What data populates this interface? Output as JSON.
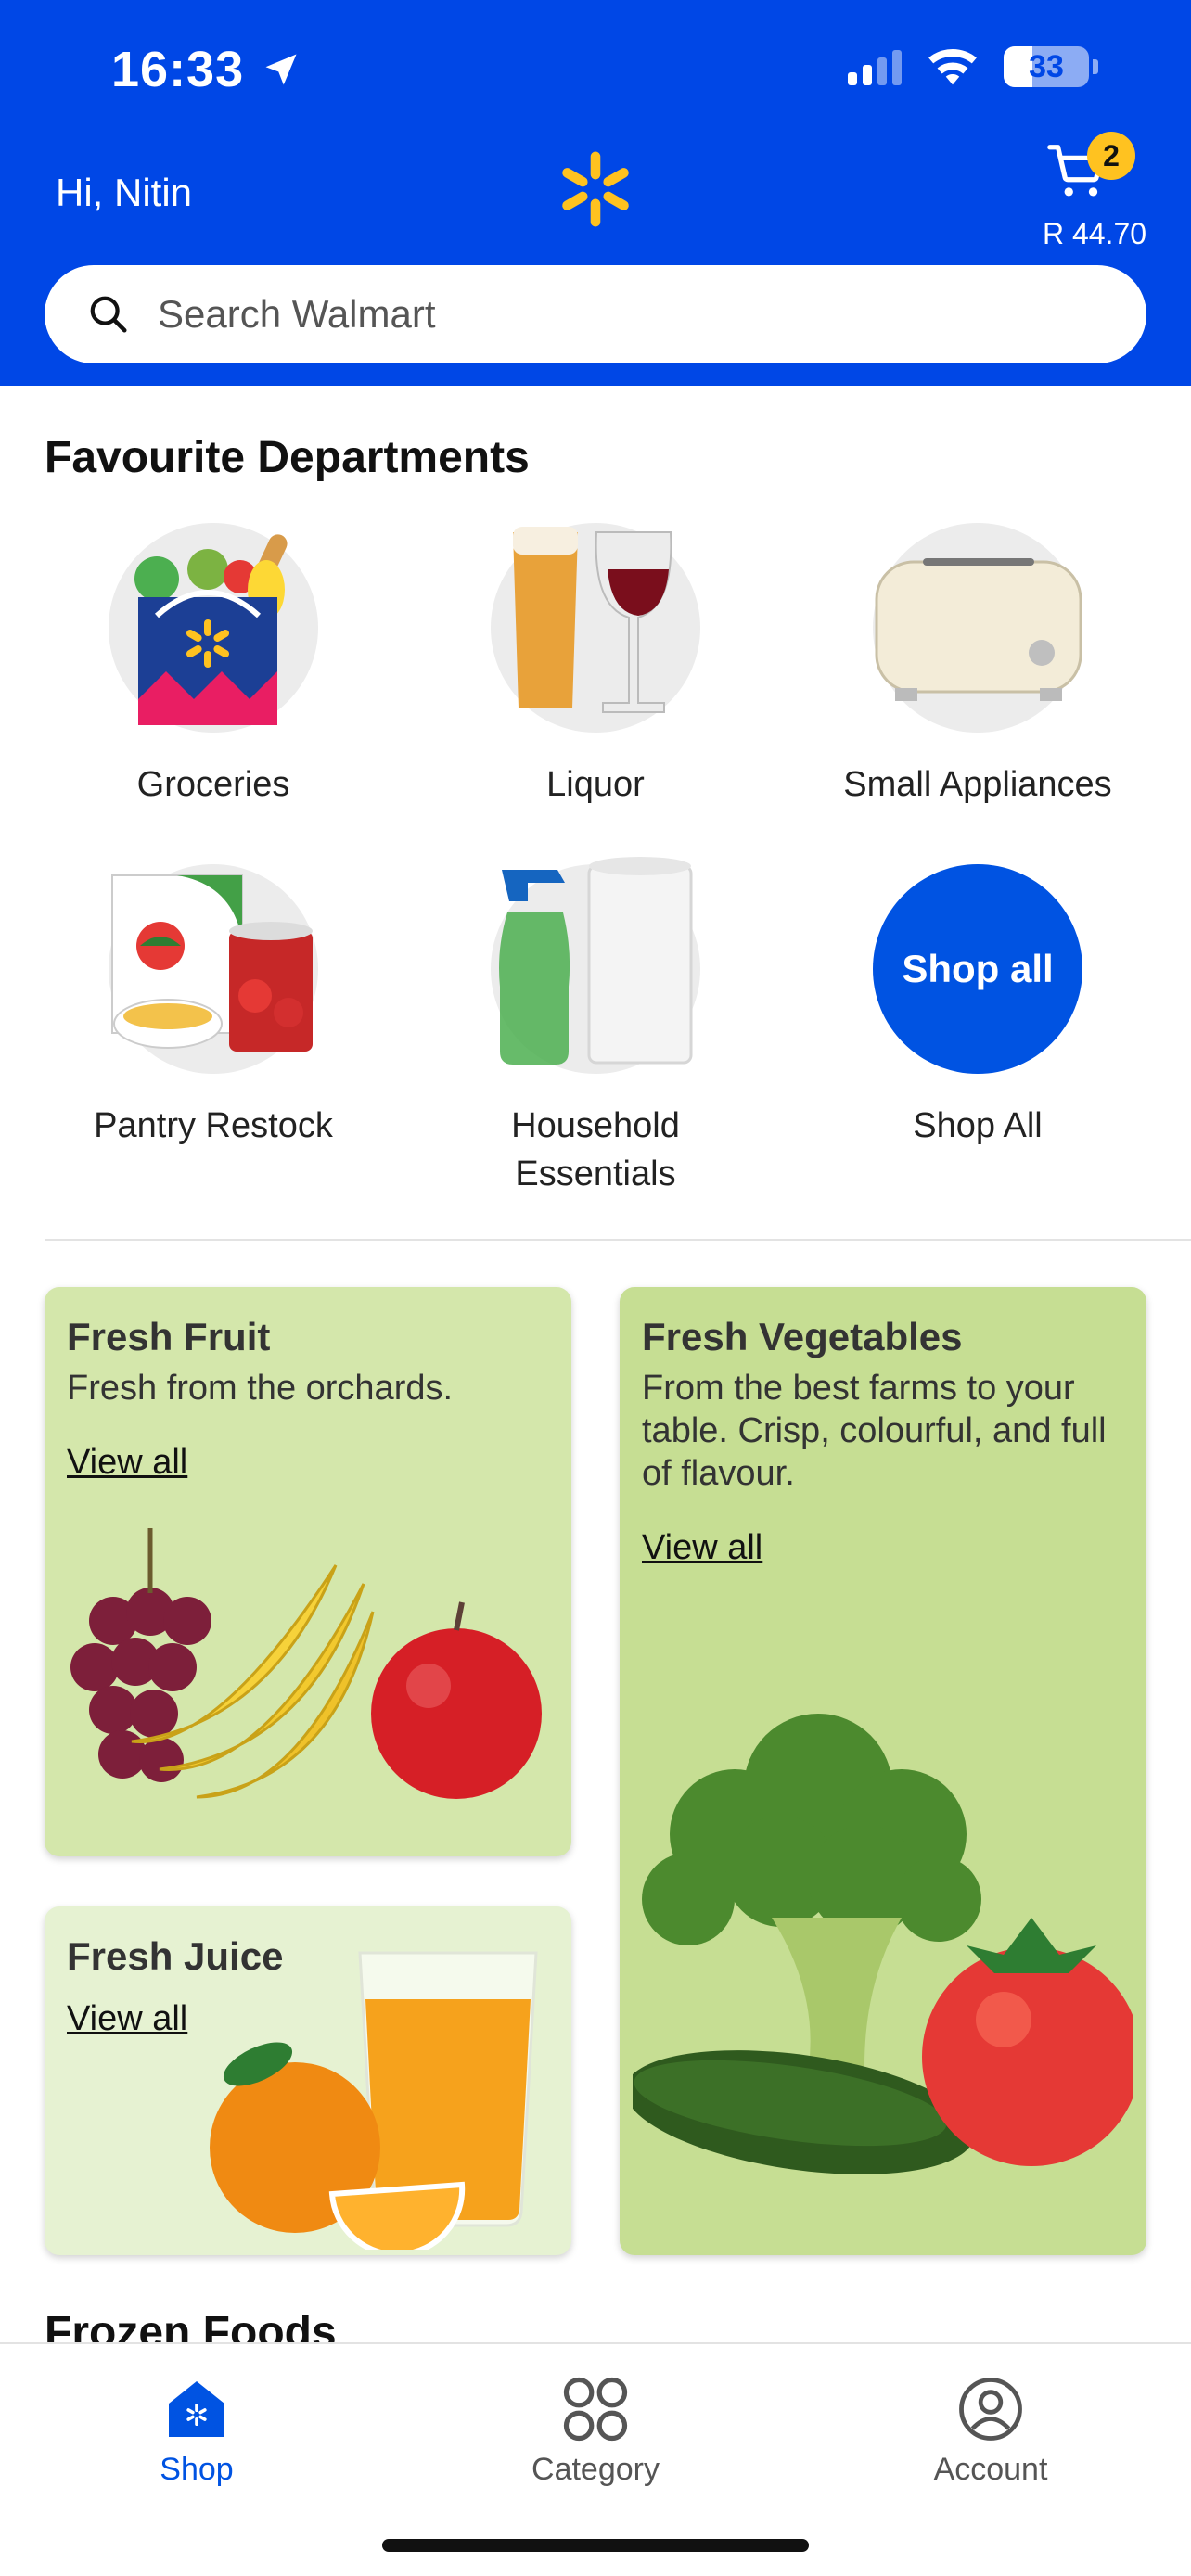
{
  "status_bar": {
    "time": "16:33",
    "battery": "33"
  },
  "header": {
    "greeting": "Hi, Nitin",
    "cart_count": "2",
    "cart_total": "R 44.70",
    "colors": {
      "brand_blue": "#0047e6",
      "spark_yellow": "#ffc220"
    }
  },
  "search": {
    "placeholder": "Search Walmart",
    "value": ""
  },
  "departments": {
    "title": "Favourite Departments",
    "items": [
      {
        "label": "Groceries",
        "icon": "grocery-bag-icon"
      },
      {
        "label": "Liquor",
        "icon": "beer-wine-icon"
      },
      {
        "label": "Small Appliances",
        "icon": "toaster-icon"
      },
      {
        "label": "Pantry Restock",
        "icon": "cereal-tin-icon"
      },
      {
        "label": "Household Essentials",
        "icon": "spray-paper-towel-icon"
      },
      {
        "label": "Shop All",
        "bubble_text": "Shop all"
      }
    ]
  },
  "cards": {
    "fruit": {
      "title": "Fresh Fruit",
      "subtitle": "Fresh from the orchards.",
      "link": "View all"
    },
    "vegetables": {
      "title": "Fresh Vegetables",
      "subtitle": "From the best farms to your table. Crisp, colourful, and full of flavour.",
      "link": "View all"
    },
    "juice": {
      "title": "Fresh Juice",
      "link": "View all"
    }
  },
  "next_section": {
    "title": "Frozen Foods"
  },
  "bottom_nav": {
    "items": [
      {
        "label": "Shop",
        "active": true
      },
      {
        "label": "Category",
        "active": false
      },
      {
        "label": "Account",
        "active": false
      }
    ]
  }
}
